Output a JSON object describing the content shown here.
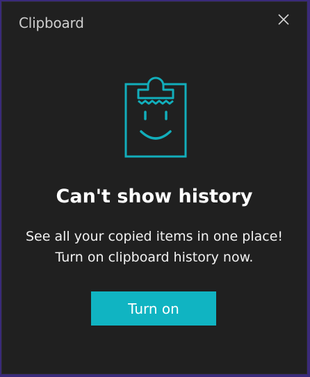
{
  "window": {
    "title": "Clipboard"
  },
  "icons": {
    "close": "close-icon",
    "illustration": "clipboard-smiley-icon"
  },
  "message": {
    "heading": "Can't show history",
    "line1": "See all your copied items in one place!",
    "line2": "Turn on clipboard history now."
  },
  "actions": {
    "turn_on_label": "Turn on"
  },
  "colors": {
    "accent": "#10b4c2",
    "background": "#202020",
    "frame": "#3a2a7a"
  }
}
